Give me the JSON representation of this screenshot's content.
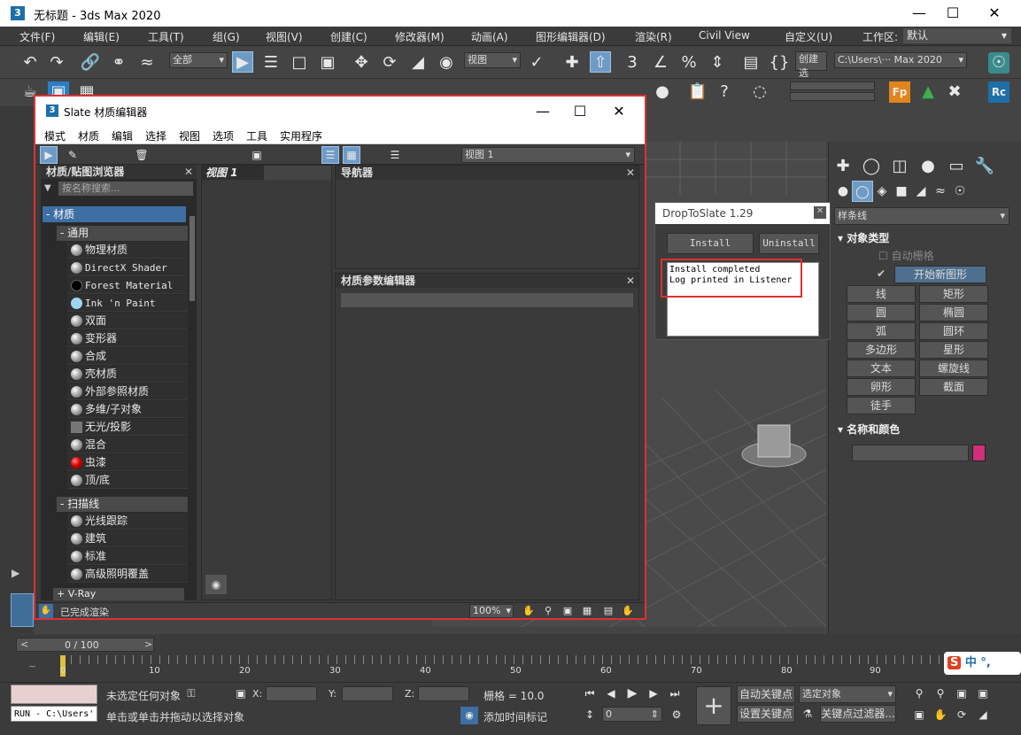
{
  "window": {
    "title": "无标题 - 3ds Max 2020",
    "logo": "3"
  },
  "menu": [
    "文件(F)",
    "编辑(E)",
    "工具(T)",
    "组(G)",
    "视图(V)",
    "创建(C)",
    "修改器(M)",
    "动画(A)",
    "图形编辑器(D)",
    "渲染(R)",
    "Civil View",
    "自定义(U)"
  ],
  "workspace": {
    "label": "工作区:",
    "value": "默认"
  },
  "toolbar": {
    "selection_filter": "全部",
    "ref_coord": "视图",
    "create_selection": "创建选",
    "path": "C:\\Users\\··· Max 2020"
  },
  "slate": {
    "logo": "3",
    "title": "Slate 材质编辑器",
    "menu": [
      "模式",
      "材质",
      "编辑",
      "选择",
      "视图",
      "选项",
      "工具",
      "实用程序"
    ],
    "view_dropdown": "视图 1",
    "browser_title": "材质/贴图浏览器",
    "search_placeholder": "按名称搜索...",
    "cat_materials": "- 材质",
    "grp_general": "- 通用",
    "general_items": [
      "物理材质",
      "DirectX Shader",
      "Forest Material",
      "Ink 'n Paint",
      "双面",
      "变形器",
      "合成",
      "壳材质",
      "外部参照材质",
      "多维/子对象",
      "无光/投影",
      "混合",
      "虫漆",
      "顶/底"
    ],
    "grp_scanline": "- 扫描线",
    "scanline_items": [
      "光线跟踪",
      "建筑",
      "标准",
      "高级照明覆盖"
    ],
    "grp_vray": "+ V-Ray",
    "view_tab": "视图 1",
    "navigator_title": "导航器",
    "param_editor_title": "材质参数编辑器",
    "status": "已完成渲染",
    "zoom": "100%"
  },
  "droptoslate": {
    "title": "DropToSlate 1.29",
    "install": "Install",
    "uninstall": "Uninstall",
    "log": [
      "Install completed",
      "Log printed in Listener"
    ]
  },
  "command_panel": {
    "category": "样条线",
    "object_type_title": "对象类型",
    "autogrid": "自动栅格",
    "start_new_shape": "开始新图形",
    "shapes": [
      "线",
      "矩形",
      "圆",
      "椭圆",
      "弧",
      "圆环",
      "多边形",
      "星形",
      "文本",
      "螺旋线",
      "卵形",
      "截面",
      "徒手"
    ],
    "name_color_title": "名称和颜色",
    "object_color": "#d0307a"
  },
  "timeline": {
    "frame": "0 / 100",
    "ticks": [
      "0",
      "10",
      "20",
      "30",
      "40",
      "50",
      "60",
      "70",
      "80",
      "90"
    ]
  },
  "statusbar": {
    "script_line": "RUN - C:\\Users'",
    "selection_status": "未选定任何对象",
    "prompt": "单击或单击并拖动以选择对象",
    "x_label": "X:",
    "y_label": "Y:",
    "z_label": "Z:",
    "grid": "栅格 = 10.0",
    "add_time_tag": "添加时间标记",
    "auto_key": "自动关键点",
    "set_key": "设置关键点",
    "selected_object": "选定对象",
    "key_filter": "关键点过滤器...",
    "frame_value": "0"
  }
}
